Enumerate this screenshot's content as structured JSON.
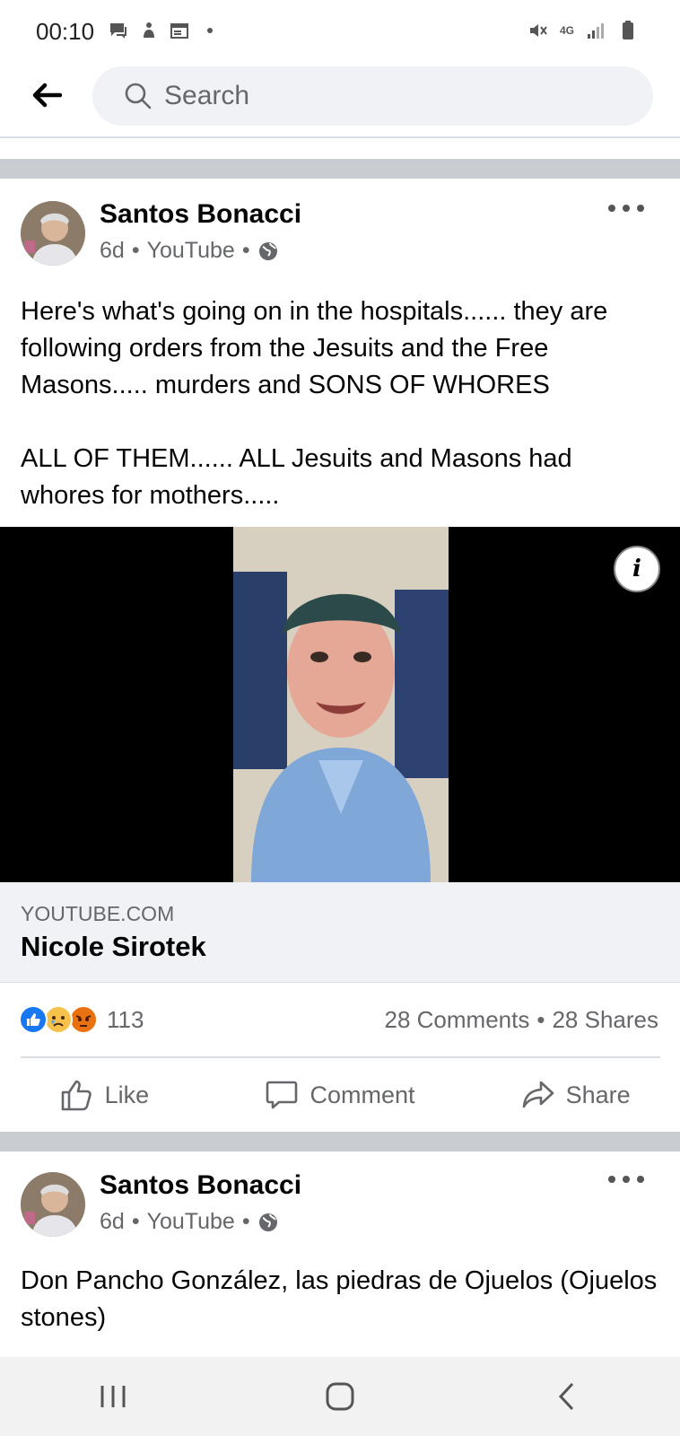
{
  "status_bar": {
    "time": "00:10",
    "network": "4G"
  },
  "search": {
    "placeholder": "Search"
  },
  "posts": [
    {
      "author": "Santos Bonacci",
      "time": "6d",
      "source": "YouTube",
      "text": "Here's what's going on in the hospitals...... they are following orders from the Jesuits and the Free Masons..... murders and SONS OF WHORES\n\nALL OF THEM...... ALL Jesuits and Masons had whores for mothers.....",
      "link": {
        "domain": "YOUTUBE.COM",
        "title": "Nicole Sirotek"
      },
      "reactions": {
        "types": [
          "like",
          "sad",
          "angry"
        ],
        "count": "113"
      },
      "comments": "28 Comments",
      "shares": "28 Shares"
    },
    {
      "author": "Santos Bonacci",
      "time": "6d",
      "source": "YouTube",
      "text": "Don Pancho González, las piedras de Ojuelos (Ojuelos stones)"
    }
  ],
  "actions": {
    "like": "Like",
    "comment": "Comment",
    "share": "Share"
  },
  "meta_separator": "•",
  "colors": {
    "facebook_blue": "#1877f2",
    "secondary_text": "#65676b",
    "divider": "#c9ccd1"
  }
}
